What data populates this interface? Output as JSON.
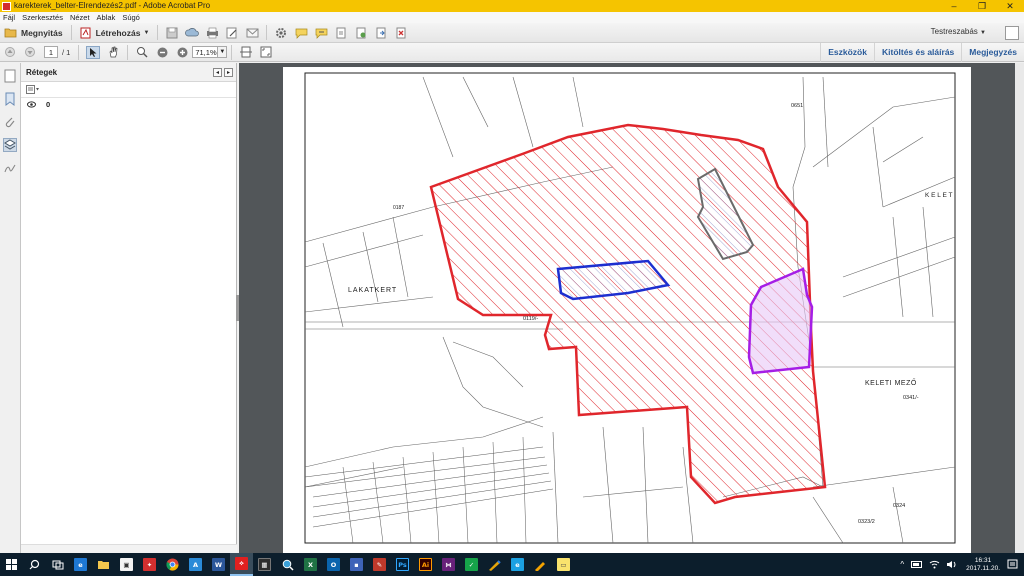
{
  "titlebar": {
    "title": "karekterek_belter-Elrendezés2.pdf - Adobe Acrobat Pro",
    "minimize": "–",
    "maximize": "❐",
    "close": "✕"
  },
  "menubar": {
    "items": [
      "Fájl",
      "Szerkesztés",
      "Nézet",
      "Ablak",
      "Súgó"
    ]
  },
  "toolbar1": {
    "open_label": "Megnyitás",
    "create_label": "Létrehozás",
    "customize_label": "Testreszabás"
  },
  "toolbar2": {
    "page_current": "1",
    "page_total": "/ 1",
    "zoom": "71,1%",
    "links": [
      "Eszközök",
      "Kitöltés és aláírás",
      "Megjegyzés"
    ]
  },
  "panel": {
    "title": "Rétegek",
    "layer_name": "0"
  },
  "map": {
    "labels": {
      "lakatkert": "LAKATKERT",
      "keleti_mezo": "KELETI MEZŐ",
      "kelet": "K E L E T",
      "p0119": "0119/-",
      "p0341": "0341/-",
      "p0324": "0324",
      "p0323": "0323/2",
      "p0187": "0187",
      "p0651": "0651"
    },
    "colors": {
      "red_zone": "#e0262c",
      "blue_zone": "#1d2fd0",
      "purple_zone": "#a51ee6",
      "gray_zone": "#6a6a6a"
    }
  },
  "taskbar": {
    "time": "16:31",
    "date": "2017.11.20."
  }
}
